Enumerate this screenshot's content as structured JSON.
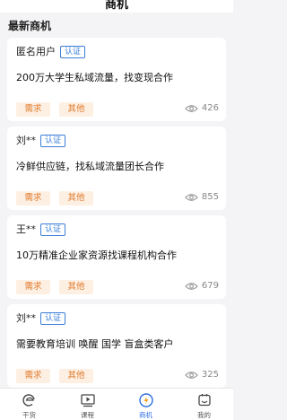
{
  "header": {
    "title": "商机"
  },
  "section": {
    "title": "最新商机"
  },
  "cards": [
    {
      "author": "匿名用户",
      "badge": "认证",
      "title": "200万大学生私域流量，找变现合作",
      "tags": [
        "需求",
        "其他"
      ],
      "views": "426"
    },
    {
      "author": "刘**",
      "badge": "认证",
      "title": "冷鲜供应链，找私域流量团长合作",
      "tags": [
        "需求",
        "其他"
      ],
      "views": "855"
    },
    {
      "author": "王**",
      "badge": "认证",
      "title": "10万精准企业家资源找课程机构合作",
      "tags": [
        "需求",
        "其他"
      ],
      "views": "679"
    },
    {
      "author": "刘**",
      "badge": "认证",
      "title": "需要教育培训 唤醒 国学 盲盒类客户",
      "tags": [
        "需求",
        "其他"
      ],
      "views": "325"
    }
  ],
  "tabbar": {
    "items": [
      {
        "label": "干货",
        "icon": "dry-goods-icon"
      },
      {
        "label": "课程",
        "icon": "course-icon"
      },
      {
        "label": "商机",
        "icon": "business-icon"
      },
      {
        "label": "我的",
        "icon": "profile-icon"
      }
    ],
    "active": 2
  },
  "colors": {
    "accent": "#2f6fe0",
    "badge": "#3b7fd8",
    "tag_text": "#e0782a",
    "tag_bg": "#fdf0e3"
  }
}
